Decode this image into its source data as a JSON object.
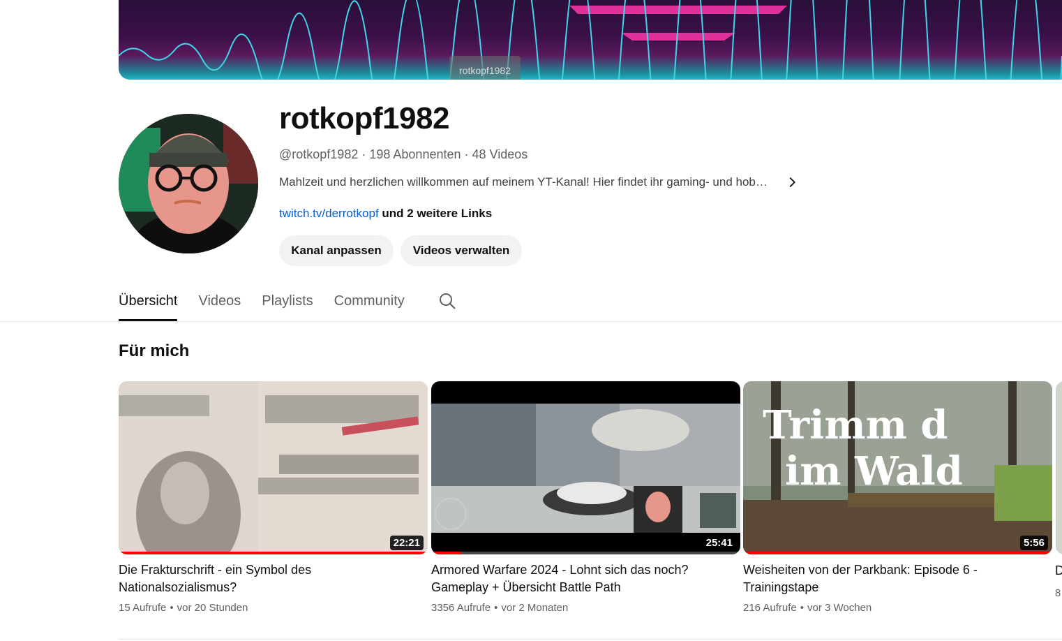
{
  "banner": {
    "tooltip": "rotkopf1982"
  },
  "channel": {
    "name": "rotkopf1982",
    "handle": "@rotkopf1982",
    "subscribers": "198 Abonnenten",
    "videos": "48 Videos",
    "description": "Mahlzeit und herzlichen willkommen auf meinem YT-Kanal! Hier findet ihr gaming- und hob…",
    "link": "twitch.tv/derrotkopf",
    "more_links": "und 2 weitere Links"
  },
  "buttons": {
    "customize": "Kanal anpassen",
    "manage": "Videos verwalten"
  },
  "tabs": [
    {
      "label": "Übersicht",
      "active": true
    },
    {
      "label": "Videos"
    },
    {
      "label": "Playlists"
    },
    {
      "label": "Community"
    }
  ],
  "section": {
    "title": "Für mich"
  },
  "videos": [
    {
      "title": "Die Frakturschrift - ein Symbol des Nationalsozialismus?",
      "duration": "22:21",
      "views": "15 Aufrufe",
      "age": "vor 20 Stunden",
      "progress": 1.0
    },
    {
      "title": "Armored Warfare 2024 - Lohnt sich das noch? Gameplay + Übersicht Battle Path",
      "duration": "25:41",
      "views": "3356 Aufrufe",
      "age": "vor 2 Monaten",
      "progress": 0.1
    },
    {
      "title": "Weisheiten von der Parkbank: Episode 6 - Trainingstape",
      "duration": "5:56",
      "views": "216 Aufrufe",
      "age": "vor 3 Wochen",
      "progress": 1.0,
      "thumb_text_1": "Trimm d",
      "thumb_text_2": "im Wald"
    }
  ],
  "peek": {
    "title_char": "D",
    "meta_char": "8"
  },
  "icons": {
    "chevron": "chevron-right-icon",
    "search": "search-icon"
  },
  "colors": {
    "link": "#065fd4",
    "progress": "#ff0000"
  }
}
